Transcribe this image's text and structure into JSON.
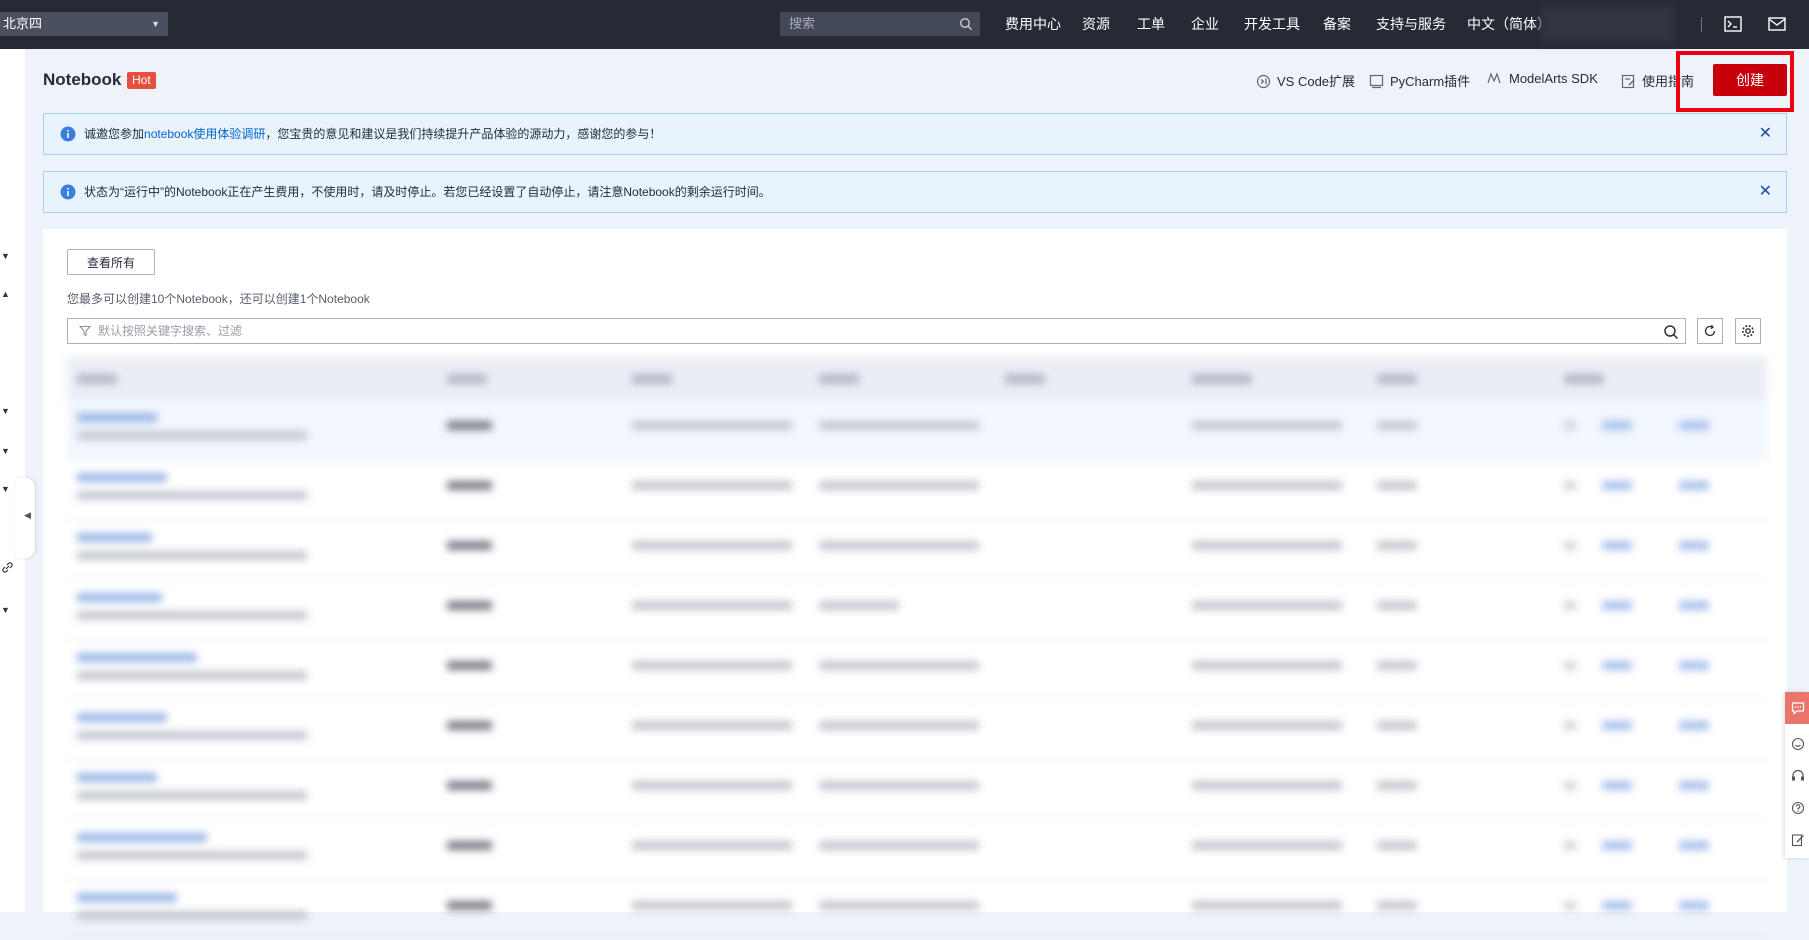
{
  "topbar": {
    "region": "北京四",
    "search_placeholder": "搜索",
    "nav": [
      "费用中心",
      "资源",
      "工单",
      "企业",
      "开发工具",
      "备案",
      "支持与服务",
      "中文（简体）"
    ]
  },
  "header": {
    "title": "Notebook",
    "hot_badge": "Hot",
    "links": {
      "vscode": "VS Code扩展",
      "pycharm": "PyCharm插件",
      "sdk": "ModelArts SDK",
      "guide": "使用指南"
    },
    "create_label": "创建"
  },
  "notices": {
    "survey_before": "诚邀您参加",
    "survey_link": "notebook使用体验调研",
    "survey_after": "，您宝贵的意见和建议是我们持续提升产品体验的源动力，感谢您的参与！",
    "billing": "状态为“运行中”的Notebook正在产生费用，不使用时，请及时停止。若您已经设置了自动停止，请注意Notebook的剩余运行时间。",
    "close_glyph": "✕"
  },
  "list": {
    "view_all_label": "查看所有",
    "limit_text": "您最多可以创建10个Notebook，还可以创建1个Notebook",
    "filter_placeholder": "默认按照关键字搜索、过滤"
  },
  "colors": {
    "topbar_bg": "#252a35",
    "accent_red": "#c7000b",
    "link_blue": "#0066cc",
    "notice_bg": "#e8f3fd"
  }
}
